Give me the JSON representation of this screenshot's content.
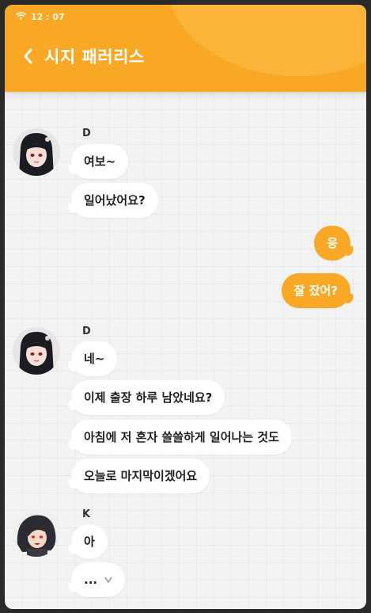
{
  "status_bar": {
    "time": "12 : 07",
    "wifi_icon": "wifi-icon"
  },
  "header": {
    "title": "시지 패러리스",
    "back_icon": "chevron-left-icon",
    "color": "#f9a825"
  },
  "messages": [
    {
      "sender": "D",
      "lines": [
        "여보~",
        "일어났어요?"
      ]
    },
    {
      "sender": "me",
      "lines": [
        "응",
        "잘 잤어?"
      ]
    },
    {
      "sender": "D",
      "lines": [
        "네~",
        "이제 출장 하루 남았네요?",
        "아침에 저 혼자 쓸쓸하게 일어나는 것도",
        "오늘로 마지막이겠어요"
      ]
    },
    {
      "sender": "K",
      "lines": [
        "아",
        "..."
      ]
    }
  ],
  "more_indicator": "chevron-down-icon",
  "colors": {
    "accent": "#f9a825",
    "bubble_left": "#ffffff",
    "text": "#222222"
  }
}
